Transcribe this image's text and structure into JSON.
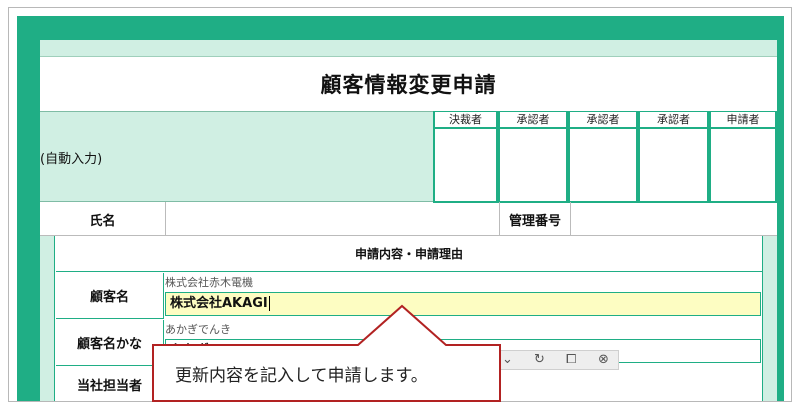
{
  "form": {
    "title": "顧客情報変更申請",
    "auto_input_label": "(自動入力)",
    "stamps": [
      "決裁者",
      "承認者",
      "承認者",
      "承認者",
      "申請者"
    ],
    "name_label": "氏名",
    "name_value": "",
    "admin_number_label": "管理番号",
    "admin_number_value": "",
    "section_title": "申請内容・申請理由",
    "fields": {
      "customer_name": {
        "label": "顧客名",
        "current": "株式会社赤木電機",
        "new_value": "株式会社AKAGI"
      },
      "customer_name_kana": {
        "label": "顧客名かな",
        "current": "あかぎでんき",
        "new_value": "あかぎ"
      },
      "staff_label": "当社担当者"
    }
  },
  "toolbar": {
    "icons": [
      "chevron-down-icon",
      "refresh-icon",
      "restore-icon",
      "close-icon"
    ],
    "glyphs": [
      "⌄",
      "↻",
      "⧠",
      "⊗"
    ]
  },
  "callout": {
    "text": "更新内容を記入して申請します。",
    "border_color": "#b22222"
  },
  "colors": {
    "frame": "#1fae85",
    "pale_green": "#d0efe3",
    "active_input": "#fdfdc2"
  }
}
